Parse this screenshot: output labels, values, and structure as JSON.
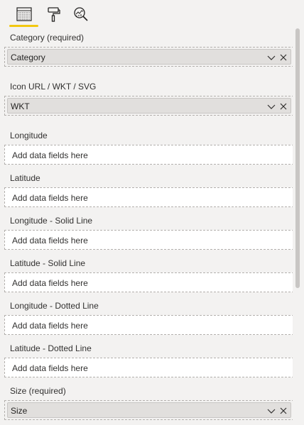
{
  "tabs": [
    {
      "id": "fields",
      "icon": "fields-grid-icon",
      "active": true
    },
    {
      "id": "format",
      "icon": "paint-roller-icon",
      "active": false
    },
    {
      "id": "analytics",
      "icon": "analytics-magnifier-icon",
      "active": false
    }
  ],
  "accent_color": "#f2c811",
  "wells": [
    {
      "label": "Category (required)",
      "field": "Category",
      "placeholder": ""
    },
    {
      "label": "Icon URL / WKT / SVG",
      "field": "WKT",
      "placeholder": ""
    },
    {
      "label": "Longitude",
      "field": "",
      "placeholder": "Add data fields here"
    },
    {
      "label": "Latitude",
      "field": "",
      "placeholder": "Add data fields here"
    },
    {
      "label": "Longitude - Solid Line",
      "field": "",
      "placeholder": "Add data fields here"
    },
    {
      "label": "Latitude - Solid Line",
      "field": "",
      "placeholder": "Add data fields here"
    },
    {
      "label": "Longitude - Dotted Line",
      "field": "",
      "placeholder": "Add data fields here"
    },
    {
      "label": "Latitude - Dotted Line",
      "field": "",
      "placeholder": "Add data fields here"
    },
    {
      "label": "Size (required)",
      "field": "Size",
      "placeholder": ""
    }
  ]
}
